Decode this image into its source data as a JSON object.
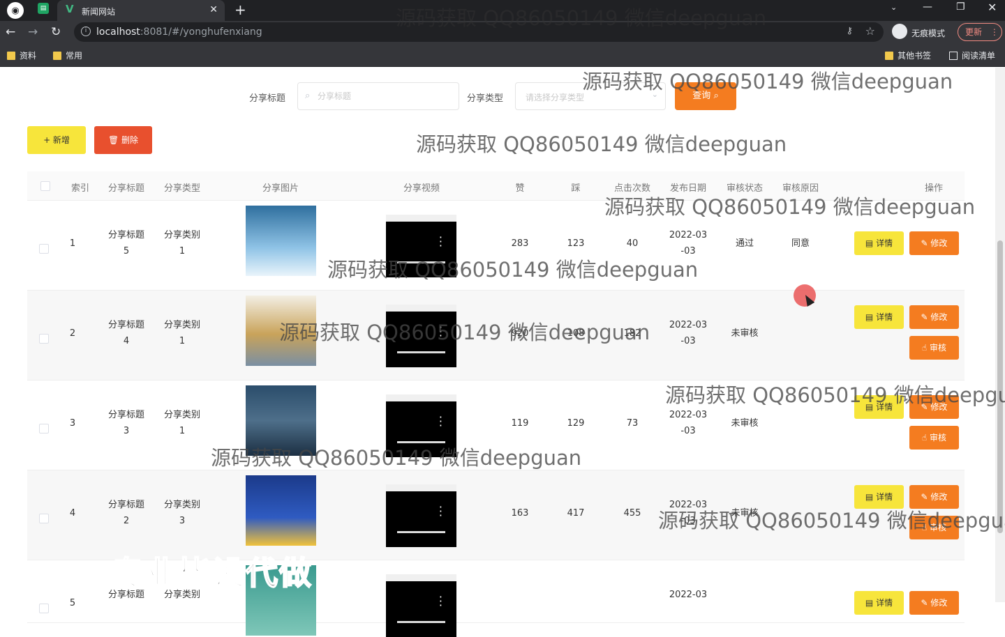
{
  "browser": {
    "tab_title": "新闻网站",
    "url_host": "localhost",
    "url_path": ":8081/#/yonghufenxiang",
    "incognito_label": "无痕模式",
    "update_label": "更新",
    "bookmarks": [
      "资料",
      "常用"
    ],
    "other_bookmarks": "其他书签",
    "reading_list": "阅读清单"
  },
  "search": {
    "title_label": "分享标题",
    "title_placeholder": "分享标题",
    "type_label": "分享类型",
    "type_placeholder": "请选择分享类型",
    "query_label": "查询"
  },
  "actions": {
    "add_label": "+ 新增",
    "delete_label": "删除"
  },
  "table": {
    "headers": {
      "index": "索引",
      "title": "分享标题",
      "type": "分享类型",
      "image": "分享图片",
      "video": "分享视频",
      "like": "赞",
      "dislike": "踩",
      "clicks": "点击次数",
      "date": "发布日期",
      "status": "审核状态",
      "reason": "审核原因",
      "ops": "操作"
    },
    "rows": [
      {
        "index": "1",
        "title": "分享标题5",
        "type": "分享类别1",
        "like": "283",
        "dislike": "123",
        "clicks": "40",
        "date": "2022-03-03",
        "status": "通过",
        "reason": "同意",
        "detail": "详情",
        "edit": "修改",
        "audit": ""
      },
      {
        "index": "2",
        "title": "分享标题4",
        "type": "分享类别1",
        "like": "920",
        "dislike": "108",
        "clicks": "182",
        "date": "2022-03-03",
        "status": "未审核",
        "reason": "",
        "detail": "详情",
        "edit": "修改",
        "audit": "审核"
      },
      {
        "index": "3",
        "title": "分享标题3",
        "type": "分享类别1",
        "like": "119",
        "dislike": "129",
        "clicks": "73",
        "date": "2022-03-03",
        "status": "未审核",
        "reason": "",
        "detail": "详情",
        "edit": "修改",
        "audit": "审核"
      },
      {
        "index": "4",
        "title": "分享标题2",
        "type": "分享类别3",
        "like": "163",
        "dislike": "417",
        "clicks": "455",
        "date": "2022-03-03",
        "status": "未审核",
        "reason": "",
        "detail": "详情",
        "edit": "修改",
        "audit": "审核"
      },
      {
        "index": "5",
        "title": "分享标题",
        "type": "分享类别",
        "like": "",
        "dislike": "",
        "clicks": "",
        "date": "2022-03",
        "status": "",
        "reason": "",
        "detail": "详情",
        "edit": "修改",
        "audit": ""
      }
    ]
  },
  "watermarks": {
    "text": "源码获取 QQ86050149 微信deepguan",
    "promo": "专业毕设代做"
  },
  "colors": {
    "accent_orange": "#f47c20",
    "accent_yellow": "#f7e53b",
    "danger": "#e8502e"
  }
}
